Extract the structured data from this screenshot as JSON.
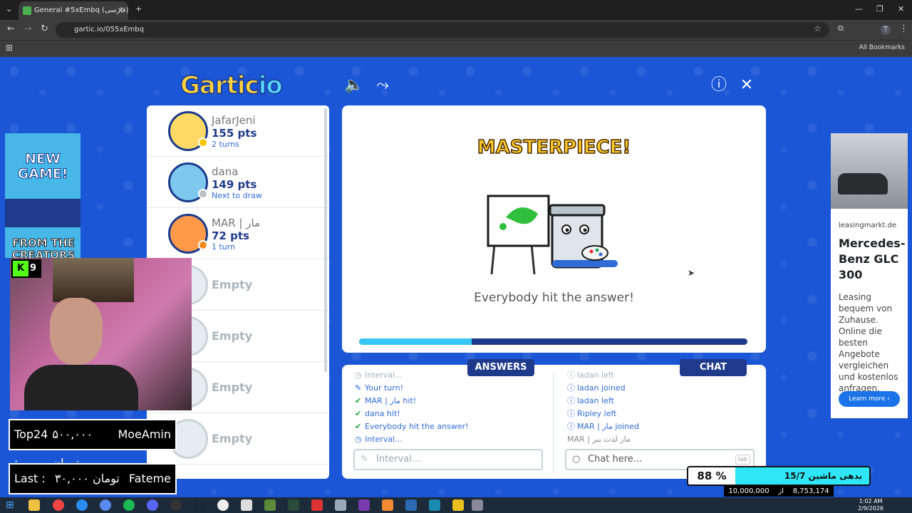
{
  "browser": {
    "tab_title": "General #5xEmbq (فارسی) - Gar",
    "url": "gartic.io/055xEmbq",
    "all_bookmarks": "All Bookmarks",
    "profile_initial": "T"
  },
  "game": {
    "logo_main": "Gartic",
    "logo_suffix": "io",
    "players": [
      {
        "name": "JafarJeni",
        "points": "155 pts",
        "status": "2 turns",
        "avatar_color": "#ffd966",
        "dot_color": "#f5c400"
      },
      {
        "name": "dana",
        "points": "149 pts",
        "status": "Next to draw",
        "avatar_color": "#7ec8f0",
        "dot_color": "#b8c2c8"
      },
      {
        "name": "MAR | مار",
        "points": "72 pts",
        "status": "1 turn",
        "avatar_color": "#ff9a4a",
        "dot_color": "#f28b1c"
      }
    ],
    "empty_slot_label": "Empty",
    "empty_slot_count": 4,
    "result_title": "MASTERPIECE!",
    "result_message": "Everybody hit the answer!",
    "progress_fraction": 0.29,
    "answers_tab": "ANSWERS",
    "chat_tab": "CHAT",
    "answers": [
      {
        "text": "Interval...",
        "icon": "clock-icon",
        "style": "faded"
      },
      {
        "text": "Your turn!",
        "icon": "pencil-icon",
        "style": "info"
      },
      {
        "text": "MAR | مار hit!",
        "icon": "check-icon",
        "style": "green"
      },
      {
        "text": "dana hit!",
        "icon": "check-icon",
        "style": "green"
      },
      {
        "text": "Everybody hit the answer!",
        "icon": "check-icon",
        "style": "green"
      },
      {
        "text": "Interval...",
        "icon": "clock-icon",
        "style": "info"
      }
    ],
    "chat": [
      {
        "text": "ladan left",
        "icon": "info-icon",
        "style": "faded"
      },
      {
        "text": "ladan joined",
        "icon": "info-icon",
        "style": "info"
      },
      {
        "text": "ladan left",
        "icon": "info-icon",
        "style": "info"
      },
      {
        "text": "Ripley left",
        "icon": "info-icon",
        "style": "info"
      },
      {
        "text": "MAR | مار joined",
        "icon": "info-icon",
        "style": "info"
      },
      {
        "text": "MAR | مار لذت ببر",
        "icon": "",
        "style": "sys"
      }
    ],
    "answer_placeholder": "Interval...",
    "chat_placeholder": "Chat here...",
    "tab_hint": "tab"
  },
  "ads": {
    "left_line1": "NEW GAME!",
    "left_line2": "FROM THE CREATORS",
    "right_domain": "leasingmarkt.de",
    "right_headline": "Mercedes-Benz GLC 300",
    "right_body": "Leasing bequem von Zuhause. Online die besten Angebote vergleichen und kostenlos anfragen.",
    "right_button": "Learn more"
  },
  "stream": {
    "kick_label": "9",
    "donor_top_label": "Top24 :",
    "donor_top_amount": "۵۰۰,۰۰۰ تومان",
    "donor_top_name": "MoeAmin",
    "donor_last_label": "Last :",
    "donor_last_amount": "۳۰,۰۰۰ تومان",
    "donor_last_name": "Fateme",
    "goal_percent": "88",
    "goal_percent_sign": "%",
    "goal_label": "بدهی ماشین 15/7",
    "goal_target": "10,000,000",
    "goal_of": "از",
    "goal_current": "8,753,174"
  },
  "taskbar": {
    "time": "1:02 AM",
    "date": "2/9/2026"
  }
}
